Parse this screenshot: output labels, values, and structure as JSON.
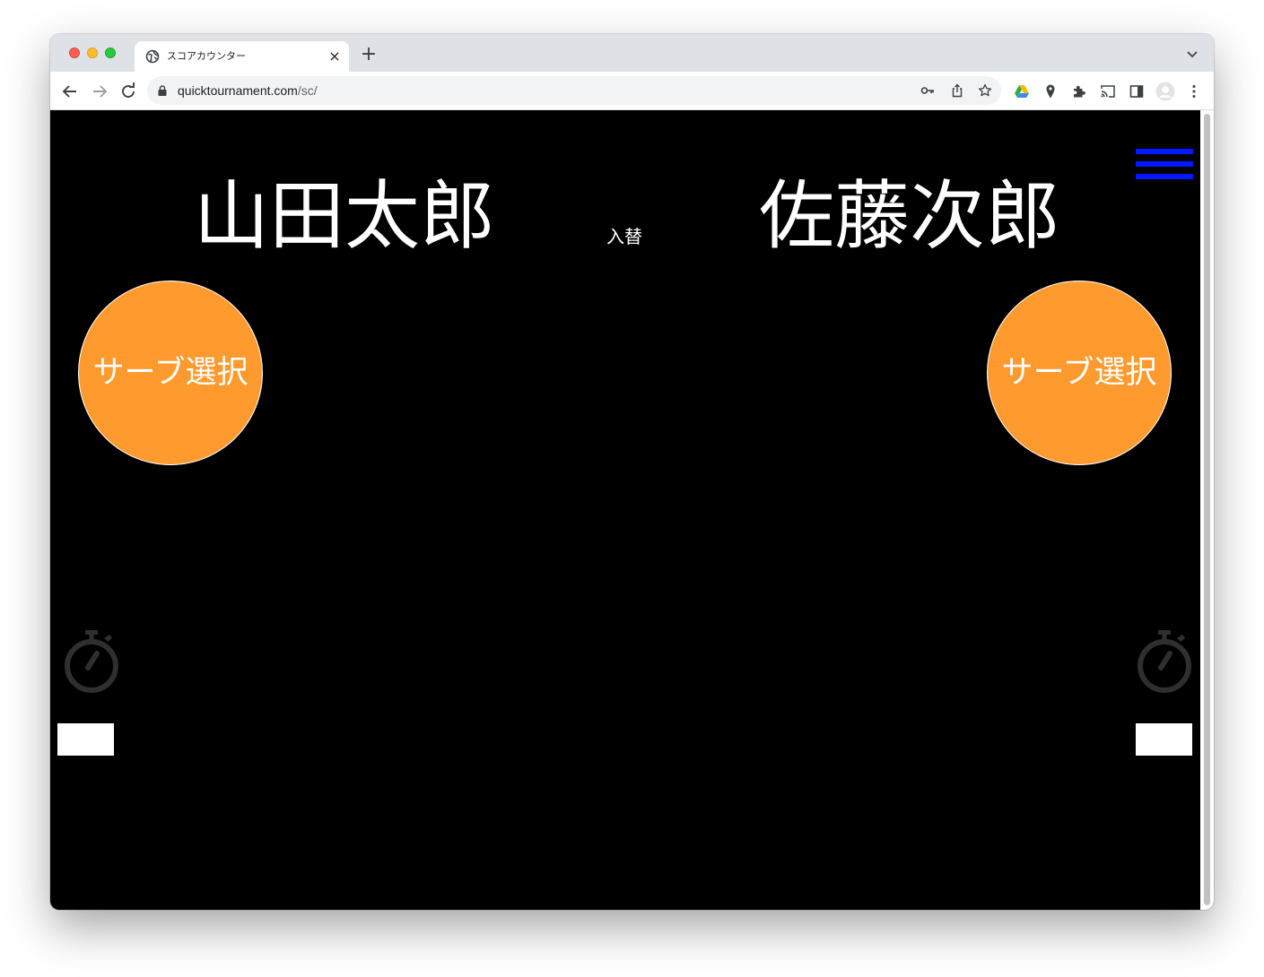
{
  "browser": {
    "tab_title": "スコアカウンター",
    "tab_close": "×",
    "new_tab": "+",
    "url_host": "quicktournament.com",
    "url_path": "/sc/"
  },
  "page": {
    "menu_icon": "hamburger-menu-icon",
    "players": {
      "left": {
        "name": "山田太郎",
        "serve_label": "サーブ選択",
        "time_value": ""
      },
      "right": {
        "name": "佐藤次郎",
        "serve_label": "サーブ選択",
        "time_value": ""
      }
    },
    "swap_label": "入替",
    "timer_icon": "stopwatch-icon"
  },
  "colors": {
    "background": "#000000",
    "text": "#ffffff",
    "serve_button": "#ff9a2e",
    "menu_bars": "#0018ff",
    "timer_icon": "#2f2f2f"
  }
}
